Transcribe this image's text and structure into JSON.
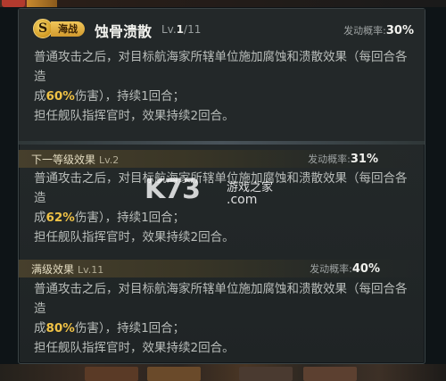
{
  "skill": {
    "coin_letter": "S",
    "type_badge": "海战",
    "name": "蚀骨溃散",
    "level_prefix": "Lv.",
    "level_current": "1",
    "level_max": "/11",
    "trigger_label": "发动概率:",
    "trigger_value": "30%"
  },
  "base_effect": {
    "line1": "普通攻击之后，对目标航海家所辖单位施加腐蚀和溃散效果（每回合各造",
    "line2_pre": "成",
    "line2_value": "60%",
    "line2_post": "伤害），持续1回合；",
    "line3": "担任舰队指挥官时，效果持续2回合。"
  },
  "next_level": {
    "title": "下一等级效果",
    "level": "Lv.2",
    "trigger_label": "发动概率:",
    "trigger_value": "31%",
    "line1": "普通攻击之后，对目标航海家所辖单位施加腐蚀和溃散效果（每回合各造",
    "line2_pre": "成",
    "line2_value": "62%",
    "line2_post": "伤害），持续1回合；",
    "line3": "担任舰队指挥官时，效果持续2回合。"
  },
  "max_level": {
    "title": "满级效果",
    "level": "Lv.11",
    "trigger_label": "发动概率:",
    "trigger_value": "40%",
    "line1": "普通攻击之后，对目标航海家所辖单位施加腐蚀和溃散效果（每回合各造",
    "line2_pre": "成",
    "line2_value": "80%",
    "line2_post": "伤害），持续1回合；",
    "line3": "担任舰队指挥官时，效果持续2回合。"
  },
  "watermark": {
    "logo": "K73",
    "cn": "游戏之家",
    "com": ".com"
  },
  "colors": {
    "highlight": "#f0c246",
    "badge": "#e2b24a",
    "panel_bg": "#232829"
  }
}
